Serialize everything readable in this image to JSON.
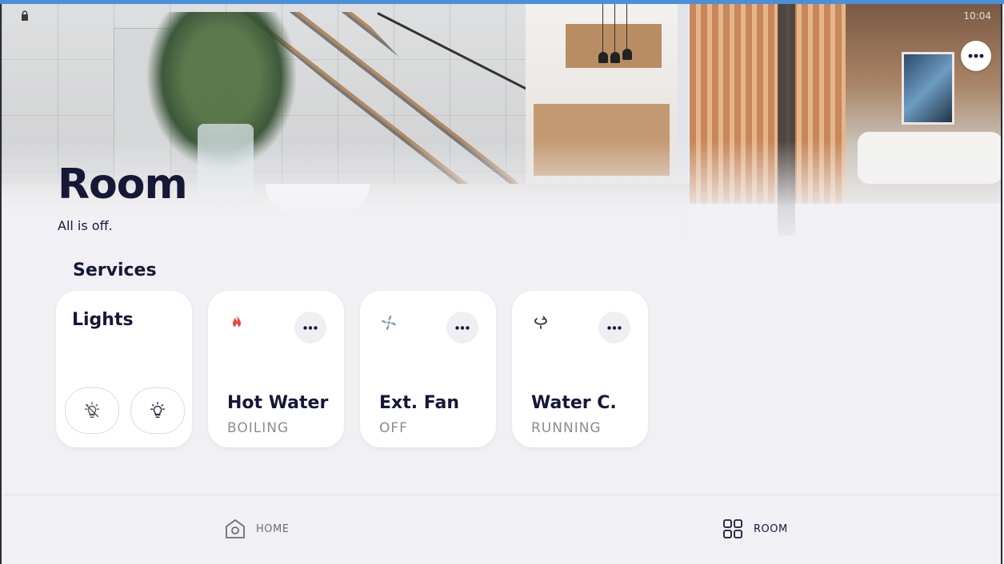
{
  "status_bar": {
    "time": "10:04"
  },
  "header": {
    "title": "Room",
    "status": "All is off.",
    "menu_icon": "more-horizontal-icon"
  },
  "services": {
    "title": "Services",
    "lights": {
      "label": "Lights",
      "off_button_icon": "light-off-icon",
      "on_button_icon": "light-on-icon"
    },
    "cards": [
      {
        "name": "Hot Water",
        "state": "BOILING",
        "icon": "flame-icon",
        "icon_color": "#e8473f"
      },
      {
        "name": "Ext. Fan",
        "state": "OFF",
        "icon": "fan-icon",
        "icon_color": "#8aa0b5"
      },
      {
        "name": "Water C.",
        "state": "RUNNING",
        "icon": "cycle-icon",
        "icon_color": "#2a2d45"
      }
    ]
  },
  "nav": {
    "items": [
      {
        "label": "HOME",
        "icon": "home-icon",
        "active": false
      },
      {
        "label": "ROOM",
        "icon": "grid-icon",
        "active": true
      }
    ]
  },
  "colors": {
    "title": "#151836",
    "accent_top": "#4a90d9",
    "background": "#f1f1f5"
  }
}
